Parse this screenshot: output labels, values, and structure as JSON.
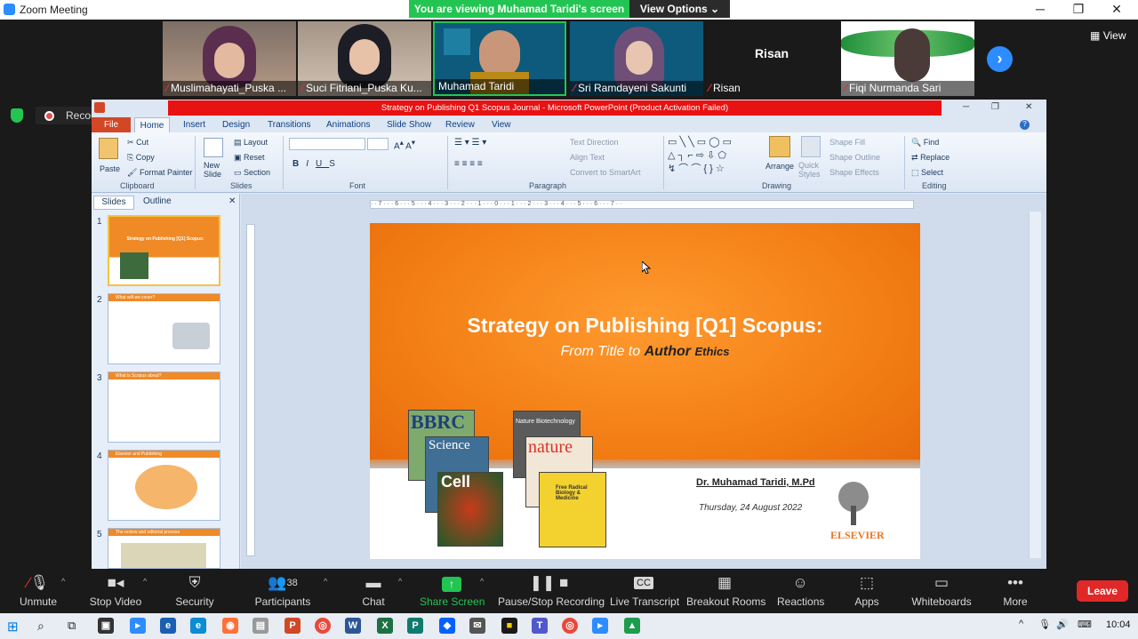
{
  "window": {
    "title": "Zoom Meeting"
  },
  "banner": {
    "text": "You are viewing Muhamad Taridi's screen",
    "view_options": "View Options"
  },
  "participants": [
    {
      "name": "Muslimahayati_Puska ...",
      "muted": true
    },
    {
      "name": "Suci Fitriani_Puska Ku...",
      "muted": true
    },
    {
      "name": "Muhamad Taridi",
      "muted": false
    },
    {
      "name": "Sri Ramdayeni Sakunti",
      "muted": true
    },
    {
      "name": "Risan",
      "muted": true,
      "center_label": "Risan"
    },
    {
      "name": "Fiqi Nurmanda Sari",
      "muted": true
    }
  ],
  "view_label": "View",
  "recording": {
    "label": "Recording..."
  },
  "powerpoint": {
    "title": "Strategy on Publishing Q1 Scopus Journal  -  Microsoft PowerPoint (Product Activation Failed)",
    "tabs": [
      "File",
      "Home",
      "Insert",
      "Design",
      "Transitions",
      "Animations",
      "Slide Show",
      "Review",
      "View"
    ],
    "ribbon": {
      "clipboard": {
        "group": "Clipboard",
        "paste": "Paste",
        "cut": "Cut",
        "copy": "Copy",
        "format_painter": "Format Painter"
      },
      "slides": {
        "group": "Slides",
        "new_slide": "New Slide",
        "layout": "Layout",
        "reset": "Reset",
        "section": "Section"
      },
      "font": {
        "group": "Font"
      },
      "paragraph": {
        "group": "Paragraph",
        "text_direction": "Text Direction",
        "align_text": "Align Text",
        "convert": "Convert to SmartArt"
      },
      "drawing": {
        "group": "Drawing",
        "arrange": "Arrange",
        "quick_styles": "Quick Styles",
        "shape_fill": "Shape Fill",
        "shape_outline": "Shape Outline",
        "shape_effects": "Shape Effects"
      },
      "editing": {
        "group": "Editing",
        "find": "Find",
        "replace": "Replace",
        "select": "Select"
      }
    },
    "panel_tabs": [
      "Slides",
      "Outline"
    ],
    "thumbnails": [
      {
        "num": "1",
        "title": "Strategy on Publishing [Q1] Scopus:"
      },
      {
        "num": "2",
        "title": "What will we cover?"
      },
      {
        "num": "3",
        "title": "What is Scopus about?"
      },
      {
        "num": "4",
        "title": "Elsevier and Publishing"
      },
      {
        "num": "5",
        "title": "The review and editorial process"
      }
    ],
    "slide": {
      "title": "Strategy on Publishing [Q1] Scopus:",
      "subtitle_pre": "From Title to ",
      "subtitle_author": "Author",
      "subtitle_ethics": "Ethics",
      "author": "Dr. Muhamad Taridi, M.Pd",
      "date": "Thursday, 24 August 2022",
      "publisher": "ELSEVIER",
      "books": [
        "BBRC",
        "Science",
        "Cell",
        "Nature Biotechnology",
        "nature",
        "Free Radical Biology & Medicine"
      ]
    }
  },
  "toolbar": {
    "unmute": "Unmute",
    "stop_video": "Stop Video",
    "security": "Security",
    "participants": "Participants",
    "participants_count": "38",
    "chat": "Chat",
    "share_screen": "Share Screen",
    "pause_stop": "Pause/Stop Recording",
    "live_transcript": "Live Transcript",
    "breakout": "Breakout Rooms",
    "reactions": "Reactions",
    "apps": "Apps",
    "whiteboards": "Whiteboards",
    "more": "More",
    "leave": "Leave"
  },
  "taskbar": {
    "time": "10:04"
  },
  "colors": {
    "accent": "#2d8cff",
    "share_green": "#23c552",
    "leave_red": "#e02828",
    "slide_orange": "#f07a12"
  }
}
